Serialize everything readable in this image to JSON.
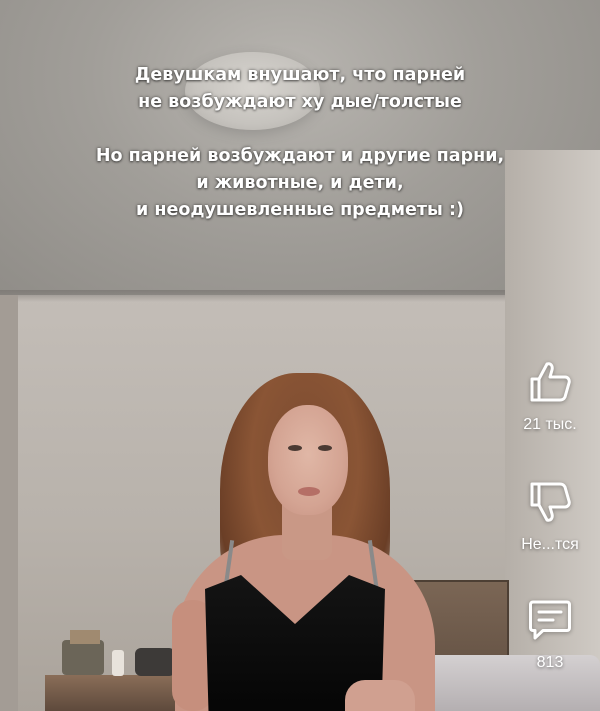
{
  "caption": {
    "line1": "Девушкам внушают, что парней",
    "line2": "не возбуждают ху дые/толстые",
    "line3": "Но парней возбуждают и другие парни,",
    "line4": "и животные, и дети,",
    "line5": "и неодушевленные предметы :)"
  },
  "actions": {
    "like": {
      "icon": "thumbs-up-icon",
      "count": "21 тыс."
    },
    "dislike": {
      "icon": "thumbs-down-icon",
      "label": "Не...тся"
    },
    "comments": {
      "icon": "comment-icon",
      "count": "813"
    }
  },
  "colors": {
    "overlay_text": "#ffffff",
    "icon": "#ffffff"
  }
}
